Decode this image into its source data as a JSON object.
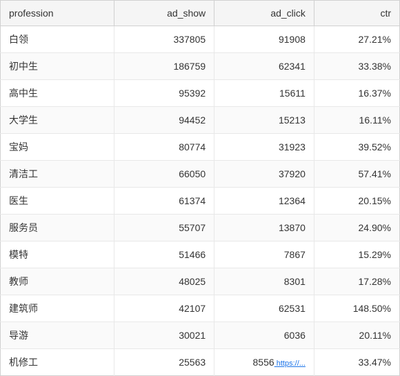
{
  "table": {
    "columns": [
      {
        "key": "profession",
        "label": "profession"
      },
      {
        "key": "ad_show",
        "label": "ad_show"
      },
      {
        "key": "ad_click",
        "label": "ad_click"
      },
      {
        "key": "ctr",
        "label": "ctr"
      }
    ],
    "rows": [
      {
        "profession": "白领",
        "ad_show": "337805",
        "ad_click": "91908",
        "ctr": "27.21%"
      },
      {
        "profession": "初中生",
        "ad_show": "186759",
        "ad_click": "62341",
        "ctr": "33.38%"
      },
      {
        "profession": "高中生",
        "ad_show": "95392",
        "ad_click": "15611",
        "ctr": "16.37%"
      },
      {
        "profession": "大学生",
        "ad_show": "94452",
        "ad_click": "15213",
        "ctr": "16.11%"
      },
      {
        "profession": "宝妈",
        "ad_show": "80774",
        "ad_click": "31923",
        "ctr": "39.52%"
      },
      {
        "profession": "清洁工",
        "ad_show": "66050",
        "ad_click": "37920",
        "ctr": "57.41%"
      },
      {
        "profession": "医生",
        "ad_show": "61374",
        "ad_click": "12364",
        "ctr": "20.15%"
      },
      {
        "profession": "服务员",
        "ad_show": "55707",
        "ad_click": "13870",
        "ctr": "24.90%"
      },
      {
        "profession": "模特",
        "ad_show": "51466",
        "ad_click": "7867",
        "ctr": "15.29%"
      },
      {
        "profession": "教师",
        "ad_show": "48025",
        "ad_click": "8301",
        "ctr": "17.28%"
      },
      {
        "profession": "建筑师",
        "ad_show": "42107",
        "ad_click": "62531",
        "ctr": "148.50%"
      },
      {
        "profession": "导游",
        "ad_show": "30021",
        "ad_click": "6036",
        "ctr": "20.11%"
      },
      {
        "profession": "机修工",
        "ad_show": "25563",
        "ad_click": "8556",
        "ctr": "33.47%"
      }
    ]
  }
}
